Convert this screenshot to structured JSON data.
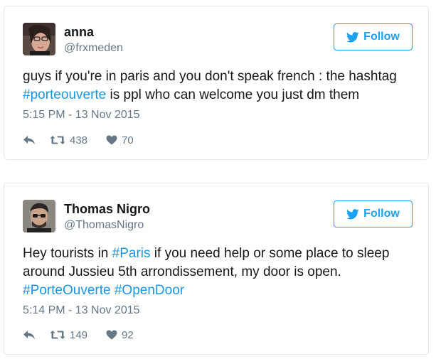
{
  "colors": {
    "link_blue": "#1b95e0",
    "follow_blue": "#1da1f2",
    "secondary_gray": "#657786",
    "border": "#e1e8ed"
  },
  "tweets": [
    {
      "display_name": "anna",
      "handle": "@frxmeden",
      "follow_label": "Follow",
      "text_before": "guys if you're in paris and you don't speak french : the hashtag ",
      "hashtag_1": "#porteouverte",
      "text_after": " is ppl who can welcome you just dm them",
      "timestamp": "5:15 PM - 13 Nov 2015",
      "retweets": "438",
      "likes": "70",
      "icons": [
        "reply-icon",
        "retweet-icon",
        "heart-icon",
        "twitter-bird-icon"
      ]
    },
    {
      "display_name": "Thomas Nigro",
      "handle": "@ThomasNigro",
      "follow_label": "Follow",
      "text_before": "Hey tourists in ",
      "hashtag_1": "#Paris",
      "text_middle": " if you need help or some place to sleep around Jussieu 5th arrondissement, my door is open. ",
      "hashtag_2": "#PorteOuverte",
      "hashtag_3": "#OpenDoor",
      "timestamp": "5:14 PM - 13 Nov 2015",
      "retweets": "149",
      "likes": "92",
      "icons": [
        "reply-icon",
        "retweet-icon",
        "heart-icon",
        "twitter-bird-icon"
      ]
    }
  ]
}
